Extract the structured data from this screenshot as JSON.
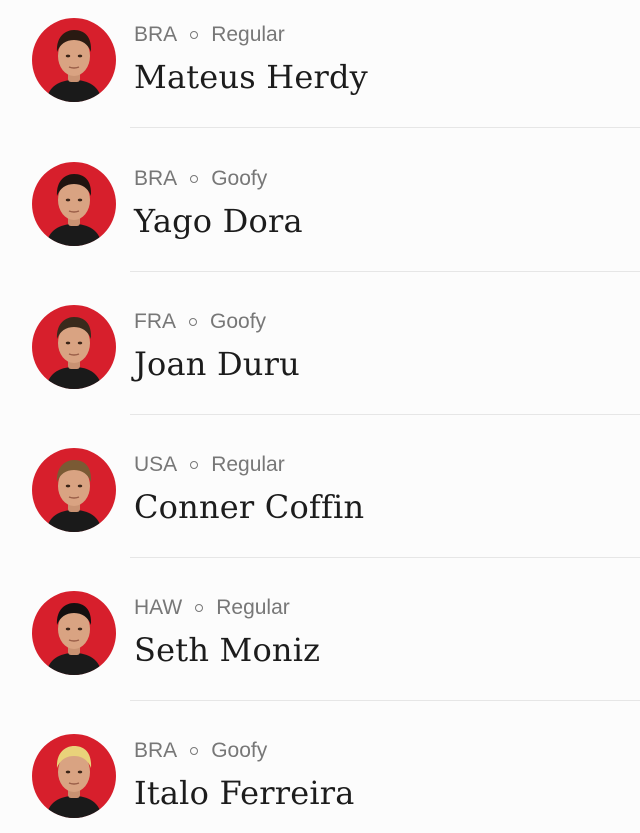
{
  "surfers": [
    {
      "country": "BRA",
      "stance": "Regular",
      "name": "Mateus Herdy",
      "avatar_icon": "surfer-portrait-icon",
      "hair_color": "#2a1a12"
    },
    {
      "country": "BRA",
      "stance": "Goofy",
      "name": "Yago Dora",
      "avatar_icon": "surfer-portrait-icon",
      "hair_color": "#1f1410"
    },
    {
      "country": "FRA",
      "stance": "Goofy",
      "name": "Joan Duru",
      "avatar_icon": "surfer-portrait-icon",
      "hair_color": "#3a2a1c"
    },
    {
      "country": "USA",
      "stance": "Regular",
      "name": "Conner Coffin",
      "avatar_icon": "surfer-portrait-icon",
      "hair_color": "#7a5a34"
    },
    {
      "country": "HAW",
      "stance": "Regular",
      "name": "Seth Moniz",
      "avatar_icon": "surfer-portrait-icon",
      "hair_color": "#141010"
    },
    {
      "country": "BRA",
      "stance": "Goofy",
      "name": "Italo Ferreira",
      "avatar_icon": "surfer-portrait-icon",
      "hair_color": "#e9d27a"
    }
  ],
  "colors": {
    "avatar_background": "#d71f2c",
    "meta_text": "#777777",
    "name_text": "#1c1c1c",
    "divider": "#e6e6e6",
    "page_background": "#fcfcfc"
  }
}
